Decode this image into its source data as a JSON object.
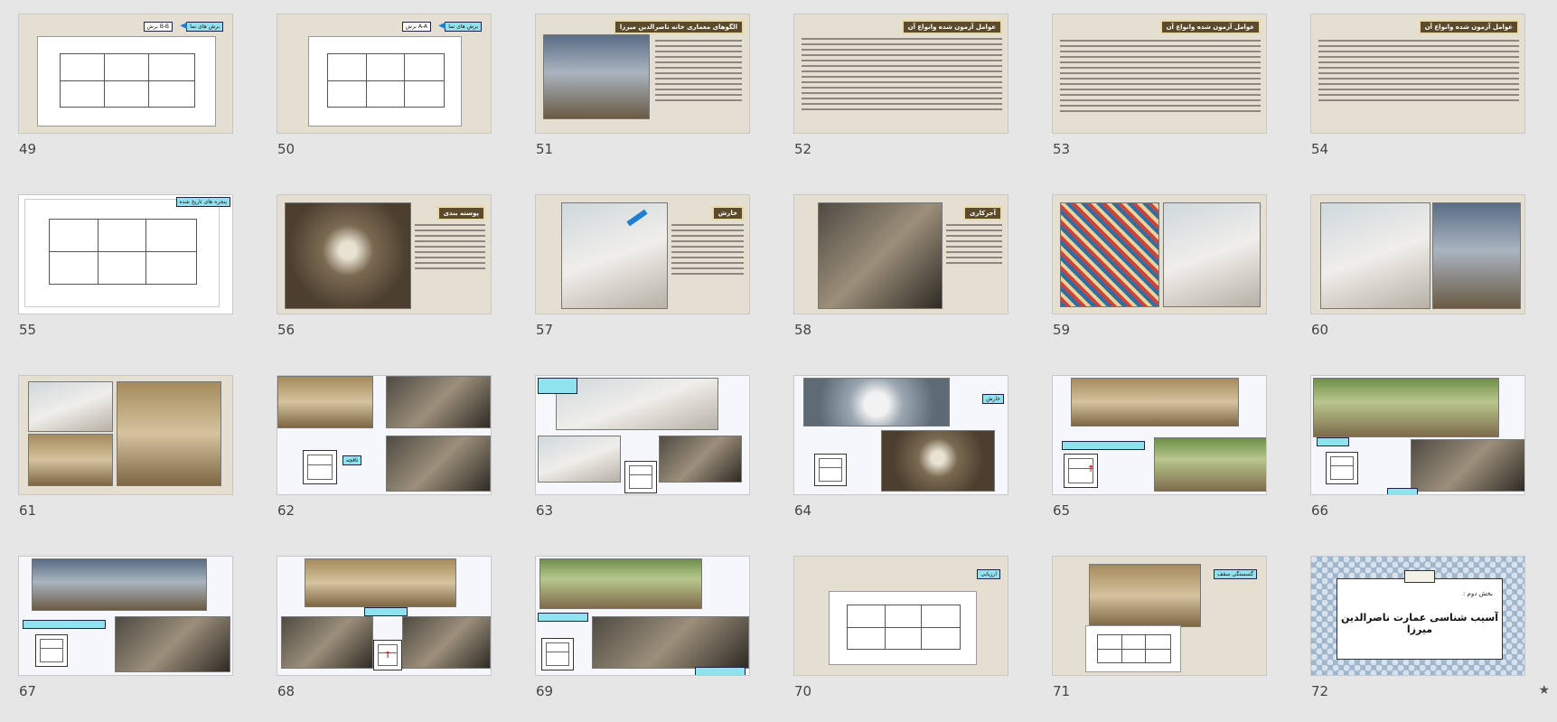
{
  "slides": [
    {
      "number": "49",
      "labels": [
        "برش های نما",
        "برش B-B"
      ]
    },
    {
      "number": "50",
      "labels": [
        "برش های نما",
        "برش A-A"
      ]
    },
    {
      "number": "51",
      "labels": [
        "الگوهای معماری خانه ناصرالدین میرزا"
      ]
    },
    {
      "number": "52",
      "labels": [
        "عوامل آزمون شده وانواع آن"
      ]
    },
    {
      "number": "53",
      "labels": [
        "عوامل آزمون شده وانواع آن"
      ]
    },
    {
      "number": "54",
      "labels": [
        "عوامل آزمون شده وانواع آن"
      ]
    },
    {
      "number": "55",
      "labels": [
        "پنجره های تاریخ شده"
      ]
    },
    {
      "number": "56",
      "labels": [
        "پوسته بندی"
      ]
    },
    {
      "number": "57",
      "labels": [
        "خارش"
      ]
    },
    {
      "number": "58",
      "labels": [
        "آجرکاری"
      ]
    },
    {
      "number": "59",
      "labels": []
    },
    {
      "number": "60",
      "labels": []
    },
    {
      "number": "61",
      "labels": []
    },
    {
      "number": "62",
      "labels": [
        "تاقچه"
      ]
    },
    {
      "number": "63",
      "labels": []
    },
    {
      "number": "64",
      "labels": [
        "خارش"
      ]
    },
    {
      "number": "65",
      "labels": []
    },
    {
      "number": "66",
      "labels": []
    },
    {
      "number": "67",
      "labels": []
    },
    {
      "number": "68",
      "labels": []
    },
    {
      "number": "69",
      "labels": []
    },
    {
      "number": "70",
      "labels": [
        "ارزیابی"
      ]
    },
    {
      "number": "71",
      "labels": [
        "گسستگی سقف"
      ]
    },
    {
      "number": "72",
      "labels": [
        "بخش دوم :",
        "آسیب شناسی عمارت ناصرالدین میرزا"
      ]
    }
  ],
  "star_icon": "★",
  "colors": {
    "background": "#e6e6e6",
    "title_box": "#5b4a2c",
    "callout": "#8ee3ee",
    "slide_beige": "#e5dfd1"
  }
}
